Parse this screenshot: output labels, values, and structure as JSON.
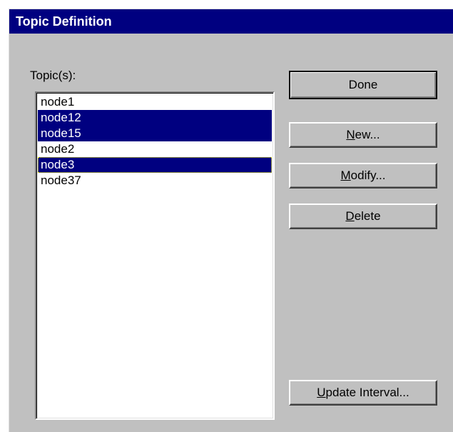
{
  "dialog": {
    "title": "Topic Definition"
  },
  "topics": {
    "label": "Topic(s):",
    "items": [
      {
        "label": "node1",
        "selected": false,
        "focused": false
      },
      {
        "label": "node12",
        "selected": true,
        "focused": false
      },
      {
        "label": "node15",
        "selected": true,
        "focused": false
      },
      {
        "label": "node2",
        "selected": false,
        "focused": false
      },
      {
        "label": "node3",
        "selected": true,
        "focused": true
      },
      {
        "label": "node37",
        "selected": false,
        "focused": false
      }
    ]
  },
  "buttons": {
    "done": {
      "label": "Done"
    },
    "new": {
      "mnemonic": "N",
      "rest": "ew..."
    },
    "modify": {
      "mnemonic": "M",
      "rest": "odify..."
    },
    "delete": {
      "mnemonic": "D",
      "rest": "elete"
    },
    "update_interval": {
      "mnemonic": "U",
      "rest": "pdate Interval..."
    }
  },
  "colors": {
    "title_bar": "#000080",
    "selection": "#000080",
    "dialog_face": "#c0c0c0"
  }
}
